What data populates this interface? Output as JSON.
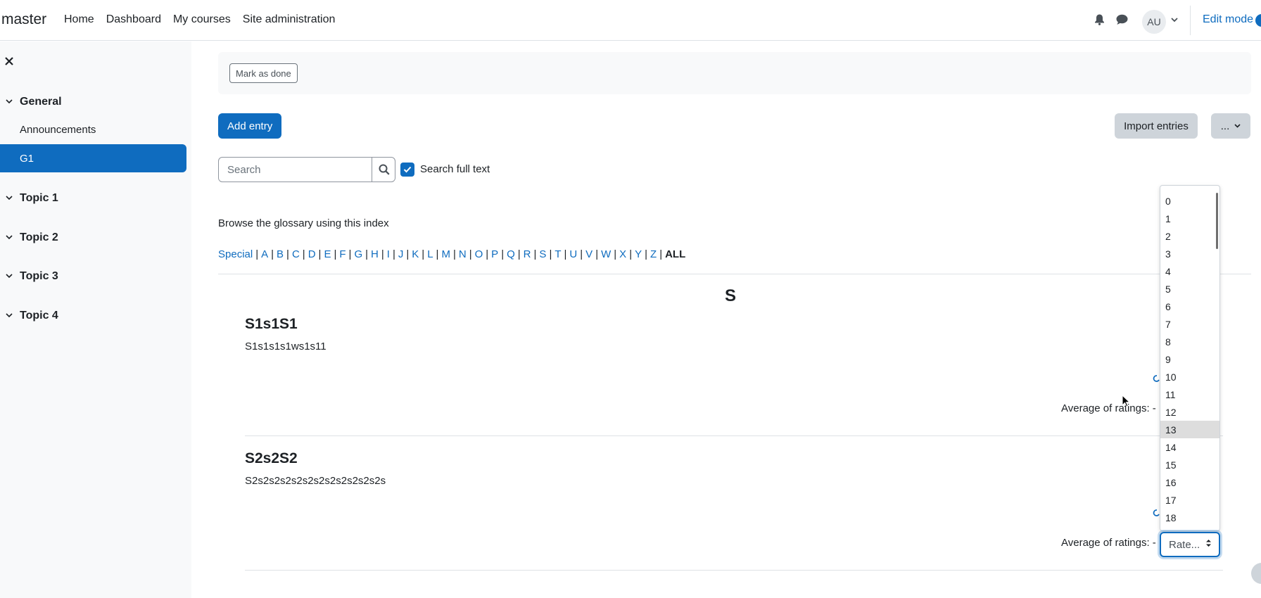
{
  "navbar": {
    "brand": "master",
    "links": [
      "Home",
      "Dashboard",
      "My courses",
      "Site administration"
    ],
    "avatar_initials": "AU",
    "edit_mode_label": "Edit mode"
  },
  "drawer": {
    "sections": [
      {
        "label": "General",
        "items": [
          "Announcements",
          "G1"
        ]
      },
      {
        "label": "Topic 1"
      },
      {
        "label": "Topic 2"
      },
      {
        "label": "Topic 3"
      },
      {
        "label": "Topic 4"
      }
    ],
    "active_item": "G1"
  },
  "main": {
    "mark_done_label": "Mark as done",
    "add_entry_label": "Add entry",
    "import_entries_label": "Import entries",
    "more_label": "...",
    "search_placeholder": "Search",
    "search_full_text_label": "Search full text",
    "search_full_text_checked": true,
    "browse_label": "Browse the glossary using this index",
    "alphabet": [
      "Special",
      "A",
      "B",
      "C",
      "D",
      "E",
      "F",
      "G",
      "H",
      "I",
      "J",
      "K",
      "L",
      "M",
      "N",
      "O",
      "P",
      "Q",
      "R",
      "S",
      "T",
      "U",
      "V",
      "W",
      "X",
      "Y",
      "Z"
    ],
    "alphabet_all": "ALL",
    "letter_heading": "S",
    "entries": [
      {
        "title": "S1s1S1",
        "body": "S1s1s1s1ws1s11",
        "rating_label": "Average of ratings: -"
      },
      {
        "title": "S2s2S2",
        "body": "S2s2s2s2s2s2s2s2s2s2s2s2s",
        "rating_label": "Average of ratings: -"
      }
    ]
  },
  "rating_select": {
    "value": "Rate...",
    "options": [
      "0",
      "1",
      "2",
      "3",
      "4",
      "5",
      "6",
      "7",
      "8",
      "9",
      "10",
      "11",
      "12",
      "13",
      "14",
      "15",
      "16",
      "17",
      "18"
    ],
    "highlighted": "13"
  },
  "colors": {
    "primary": "#0f6cbf",
    "drawer_bg": "#f8f9fa",
    "secondary_btn": "#ced4da"
  }
}
